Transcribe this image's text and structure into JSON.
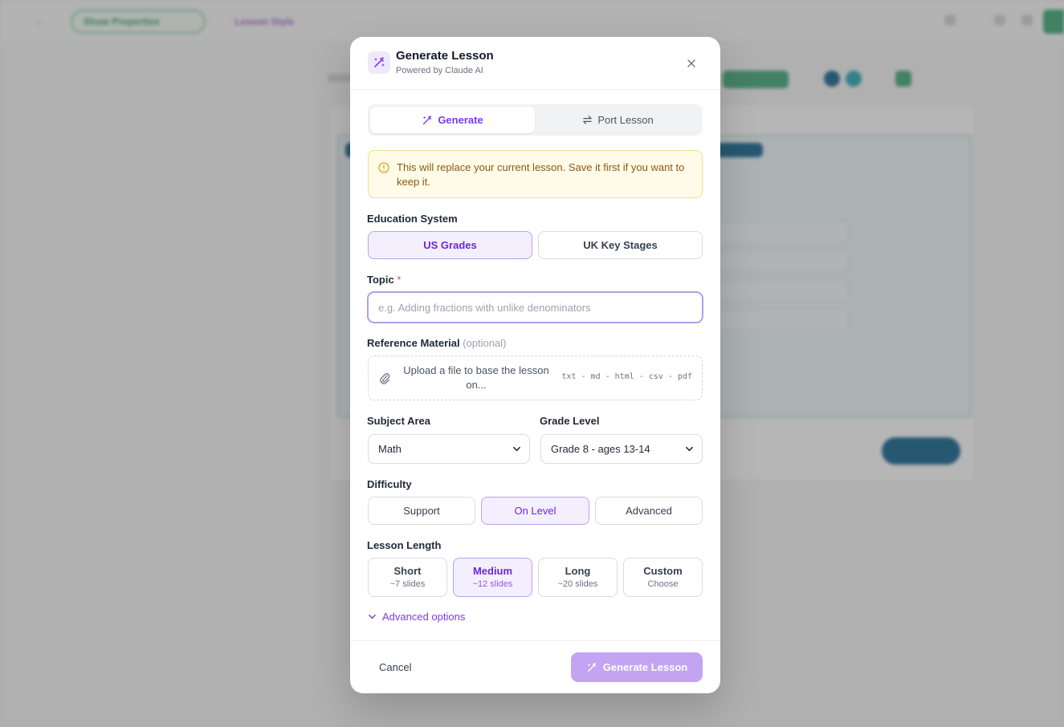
{
  "background": {
    "show_properties_label": "Show Properties",
    "lesson_style_label": "Lesson Style"
  },
  "modal": {
    "title": "Generate Lesson",
    "subtitle": "Powered by Claude AI",
    "tabs": [
      {
        "label": "Generate",
        "active": true
      },
      {
        "label": "Port Lesson",
        "active": false
      }
    ],
    "warning": "This will replace your current lesson. Save it first if you want to keep it.",
    "education_system": {
      "label": "Education System",
      "options": [
        "US Grades",
        "UK Key Stages"
      ],
      "selected": "US Grades"
    },
    "topic": {
      "label": "Topic",
      "required_mark": "*",
      "placeholder": "e.g. Adding fractions with unlike denominators",
      "value": ""
    },
    "reference": {
      "label": "Reference Material",
      "optional_text": "(optional)",
      "upload_text": "Upload a file to base the lesson on...",
      "file_types": "txt - md - html - csv - pdf"
    },
    "subject_area": {
      "label": "Subject Area",
      "value": "Math"
    },
    "grade_level": {
      "label": "Grade Level",
      "value": "Grade 8 - ages 13-14"
    },
    "difficulty": {
      "label": "Difficulty",
      "options": [
        "Support",
        "On Level",
        "Advanced"
      ],
      "selected": "On Level"
    },
    "lesson_length": {
      "label": "Lesson Length",
      "options": [
        {
          "title": "Short",
          "detail": "~7 slides"
        },
        {
          "title": "Medium",
          "detail": "~12 slides"
        },
        {
          "title": "Long",
          "detail": "~20 slides"
        },
        {
          "title": "Custom",
          "detail": "Choose"
        }
      ],
      "selected": "Medium"
    },
    "advanced_options_label": "Advanced options",
    "cancel_label": "Cancel",
    "generate_label": "Generate Lesson"
  },
  "colors": {
    "accent": "#7c3aed",
    "accent_light": "#f4effd",
    "warning_bg": "#fefbe8",
    "warning_text": "#8a5a12",
    "primary_button": "#c3a4f2"
  }
}
